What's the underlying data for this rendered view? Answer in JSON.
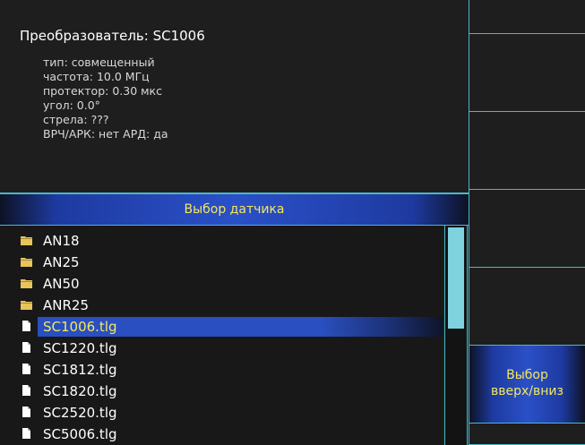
{
  "info": {
    "title": "Преобразователь: SC1006",
    "lines": [
      "тип: совмещенный",
      "частота: 10.0 МГц",
      "протектор: 0.30 мкс",
      "угол: 0.0°",
      "стрела: ???",
      "ВРЧ/АРК: нет  АРД: да"
    ]
  },
  "list_header": "Выбор датчика",
  "files": [
    {
      "name": "AN18",
      "kind": "folder"
    },
    {
      "name": "AN25",
      "kind": "folder"
    },
    {
      "name": "AN50",
      "kind": "folder"
    },
    {
      "name": "ANR25",
      "kind": "folder"
    },
    {
      "name": "SC1006.tlg",
      "kind": "file",
      "selected": true
    },
    {
      "name": "SC1220.tlg",
      "kind": "file"
    },
    {
      "name": "SC1812.tlg",
      "kind": "file"
    },
    {
      "name": "SC1820.tlg",
      "kind": "file"
    },
    {
      "name": "SC2520.tlg",
      "kind": "file"
    },
    {
      "name": "SC5006.tlg",
      "kind": "file"
    }
  ],
  "scrollbar": {
    "position": 0,
    "visible_fraction": 0.46
  },
  "softkeys": {
    "select_label": "Выбор вверх/вниз",
    "select_line1": "Выбор",
    "select_line2": "вверх/вниз"
  },
  "colors": {
    "accent_cyan": "#4ab8c8",
    "highlight_blue": "#2a50c8",
    "label_yellow": "#f5e85a",
    "folder_yellow": "#e8c45a"
  }
}
